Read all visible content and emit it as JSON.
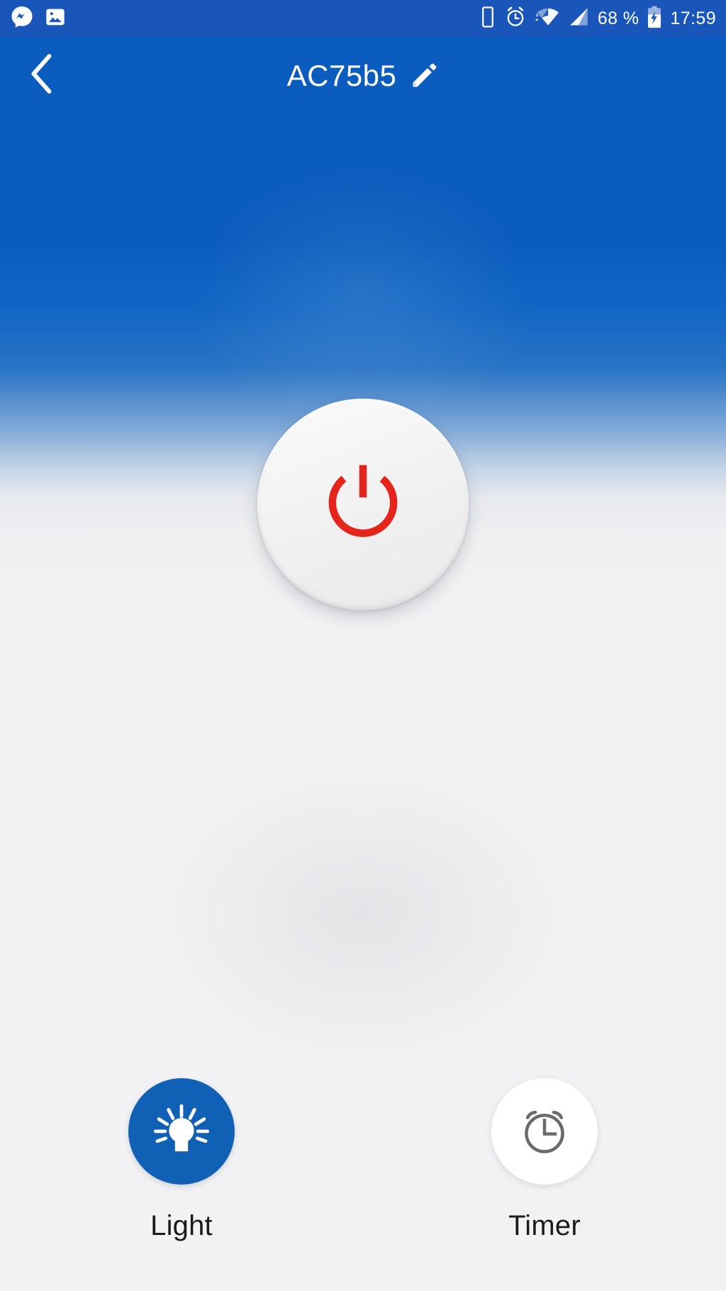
{
  "status_bar": {
    "background_color": "#1a55ba",
    "notifications": [
      {
        "icon": "messenger-icon",
        "name": "messenger"
      },
      {
        "icon": "photo-icon",
        "name": "gallery"
      }
    ],
    "indicators": [
      {
        "icon": "phone-vibrate-icon",
        "name": "phone"
      },
      {
        "icon": "alarm-clock-icon",
        "name": "alarm"
      },
      {
        "icon": "wifi-icon",
        "name": "wifi"
      },
      {
        "icon": "cell-signal-icon",
        "name": "signal"
      }
    ],
    "battery_percent": "68 %",
    "battery_icon": "battery-charging-icon",
    "time": "17:59"
  },
  "app_bar": {
    "back_icon": "chevron-left-icon",
    "title": "AC75b5",
    "edit_icon": "pencil-icon",
    "text_color": "#ffffff"
  },
  "main": {
    "power_button": {
      "icon": "power-icon",
      "state": "off",
      "icon_color": "#e5241c",
      "face_color": "#f2f2f2"
    }
  },
  "actions": [
    {
      "key": "light",
      "label": "Light",
      "icon": "lightbulb-icon",
      "circle_color": "#1060b5",
      "icon_color": "#ffffff"
    },
    {
      "key": "timer",
      "label": "Timer",
      "icon": "alarm-clock-icon",
      "circle_color": "#ffffff",
      "icon_color": "#6b6b6b"
    }
  ],
  "theme": {
    "brand_blue": "#0a5cbe",
    "status_blue": "#1a55ba",
    "accent_red": "#e5241c",
    "surface": "#f2f2f4"
  }
}
